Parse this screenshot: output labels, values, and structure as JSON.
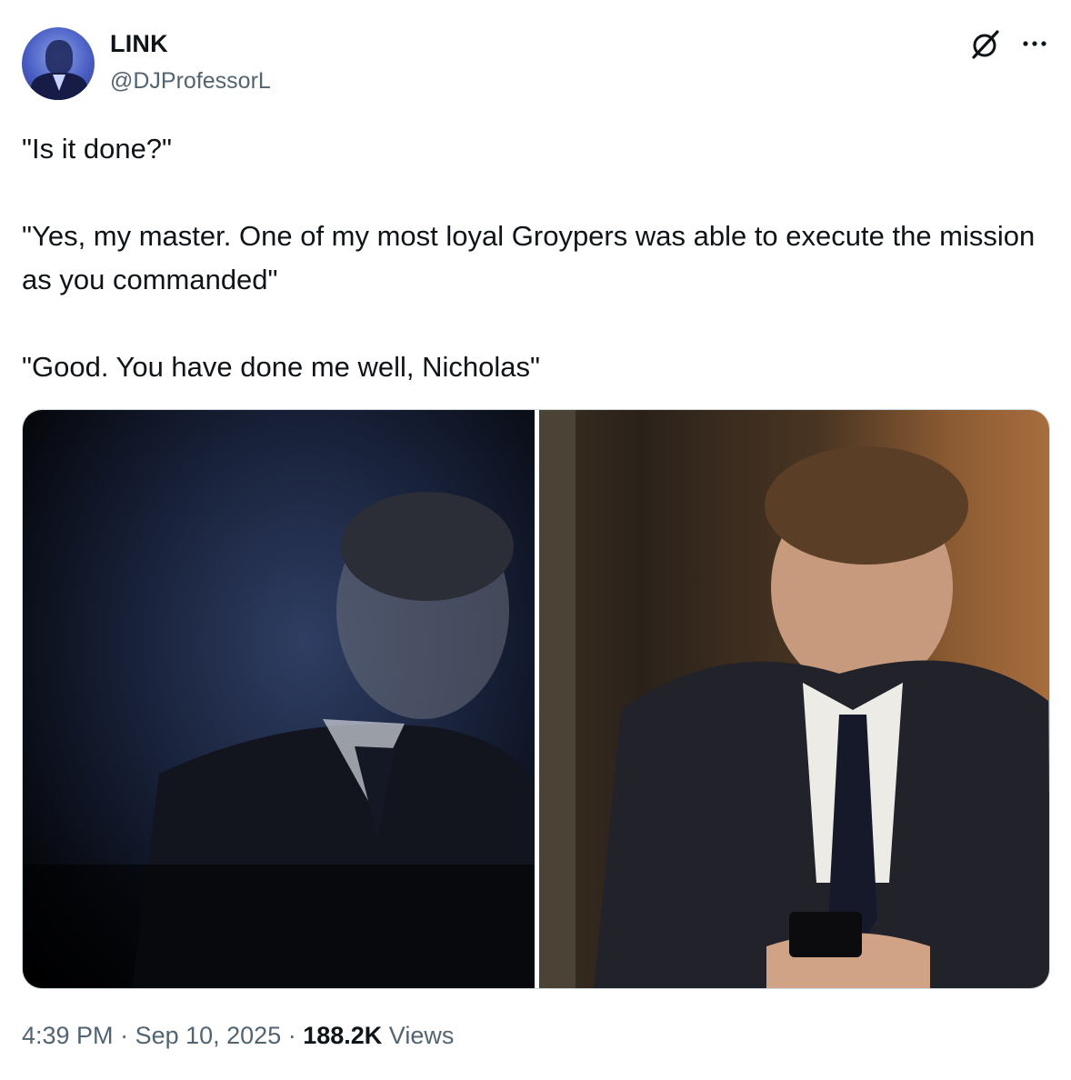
{
  "author": {
    "display_name": "LINK",
    "handle": "@DJProfessorL"
  },
  "tweet": {
    "text": "\"Is it done?\"\n\n\"Yes, my master. One of my most loyal Groypers was able to execute the mission as you commanded\"\n\n\"Good. You have done me well, Nicholas\""
  },
  "icons": {
    "grok": "grok-icon",
    "more": "more-options-icon"
  },
  "meta": {
    "time": "4:39 PM",
    "separator1": " · ",
    "date": "Sep 10, 2025",
    "separator2": " · ",
    "views_count": "188.2K",
    "views_label": " Views"
  }
}
